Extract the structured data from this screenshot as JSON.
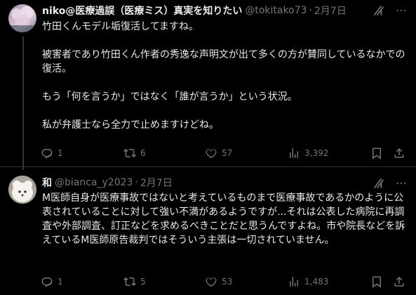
{
  "posts": [
    {
      "name": "niko@医療過誤（医療ミス）真実を知りたい",
      "handle": "@tokitako73",
      "separator": "·",
      "date": "2月7日",
      "paragraphs": [
        "竹田くんモデル垢復活してますね。",
        "被害者であり竹田くん作者の秀逸な声明文が出て多くの方が賛同しているなかでの復活。",
        "もう「何を言うか」ではなく「誰が言うか」という状況。",
        "私が弁護士なら全力で止めますけどね。"
      ],
      "replies": "1",
      "reposts": "6",
      "likes": "57",
      "views": "3,392"
    },
    {
      "name": "和",
      "handle": "@bianca_y2023",
      "separator": "·",
      "date": "2月7日",
      "paragraphs": [
        "M医師自身が医療事故ではないと考えているものまで医療事故であるかのように公表されていることに対して強い不満があるようですが...それは公表した病院に再調査や外部調査、訂正などを求めるべきことだと思うんですよね。市や院長などを訴えているM医師原告裁判ではそういう主張は一切されていません。"
      ],
      "replies": "1",
      "reposts": "5",
      "likes": "53",
      "views": "1,483"
    }
  ]
}
